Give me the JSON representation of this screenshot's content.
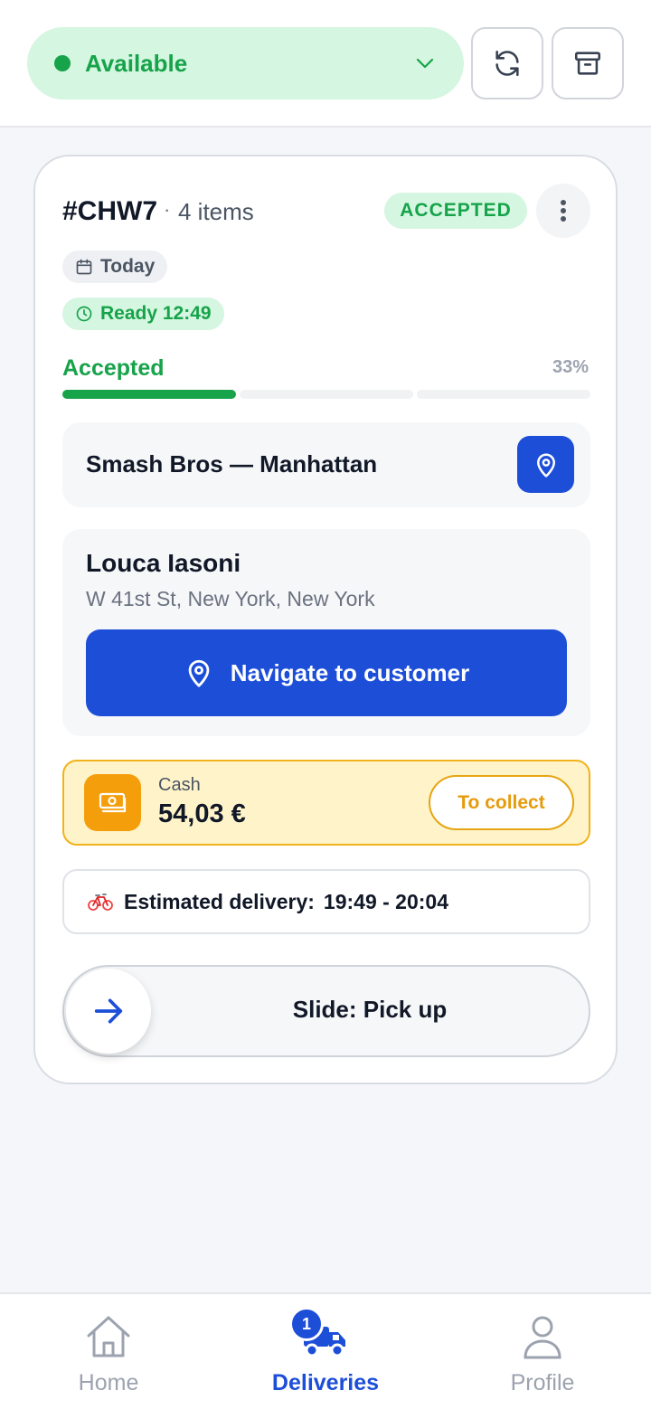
{
  "header": {
    "status_label": "Available",
    "status_color": "#16a34a",
    "refresh_icon": "refresh-icon",
    "archive_icon": "archive-icon"
  },
  "order": {
    "id": "#CHW7",
    "separator": "·",
    "items": "4 items",
    "status_badge": "ACCEPTED",
    "date_chip": "Today",
    "ready_chip": "Ready 12:49",
    "progress_label": "Accepted",
    "progress_pct": "33%",
    "progress_value": 0.33
  },
  "restaurant": {
    "name": "Smash Bros — Manhattan"
  },
  "customer": {
    "name": "Louca Iasoni",
    "address": "W 41st St, New York, New York",
    "navigate_label": "Navigate to customer"
  },
  "payment": {
    "method": "Cash",
    "amount": "54,03 €",
    "collect_label": "To collect"
  },
  "eta": {
    "label": "Estimated delivery:",
    "time": "19:49 - 20:04"
  },
  "slider": {
    "label": "Slide: Pick up"
  },
  "bottom_nav": {
    "items": [
      {
        "label": "Home",
        "icon": "home-icon"
      },
      {
        "label": "Deliveries",
        "icon": "truck-icon",
        "badge": "1"
      },
      {
        "label": "Profile",
        "icon": "user-icon"
      }
    ]
  },
  "colors": {
    "accent": "#1d4ed8",
    "success": "#16a34a",
    "warning": "#f59e0b"
  }
}
